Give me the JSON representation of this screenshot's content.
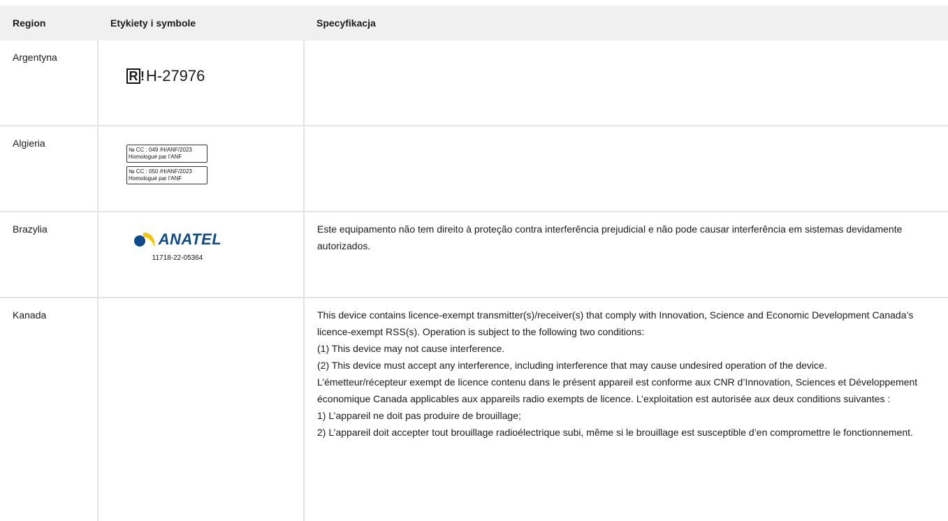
{
  "headers": {
    "region": "Region",
    "labels": "Etykiety i symbole",
    "spec": "Specyfikacja"
  },
  "rows": {
    "argentina": {
      "region": "Argentyna",
      "mark_prefix": "R",
      "mark_excl": "!",
      "code": "H-27976"
    },
    "algeria": {
      "region": "Algieria",
      "box1_line1": "№ CC : 049 /H/ANF/2023",
      "box1_line2": "Homologué par l'ANF",
      "box2_line1": "№ CC : 050 /H/ANF/2023",
      "box2_line2": "Homologué par l'ANF"
    },
    "brazil": {
      "region": "Brazylia",
      "logo_word": "ANATEL",
      "cert_number": "11718-22-05364",
      "spec": "Este equipamento não tem direito à proteção contra interferência prejudicial e não pode causar interferência em sistemas devidamente autorizados."
    },
    "canada": {
      "region": "Kanada",
      "lines": [
        "This device contains licence-exempt transmitter(s)/receiver(s) that comply with Innovation, Science and Economic Development Canada’s licence-exempt RSS(s). Operation is subject to the following two conditions:",
        "(1) This device may not cause interference.",
        "(2) This device must accept any interference, including interference that may cause undesired operation of the device.",
        "L’émetteur/récepteur exempt de licence contenu dans le présent appareil est conforme aux CNR d’Innovation, Sciences et Développement économique Canada applicables aux appareils radio exempts de licence. L’exploitation est autorisée aux deux conditions suivantes :",
        "1) L’appareil ne doit pas produire de brouillage;",
        "2) L’appareil doit accepter tout brouillage radioélectrique subi, même si le brouillage est susceptible d’en compromettre le fonctionnement."
      ]
    }
  },
  "colors": {
    "header_bg": "#f0f0f0",
    "border": "#e4e4e4",
    "anatel_blue": "#0d4a8c",
    "anatel_yellow": "#f5c400"
  }
}
